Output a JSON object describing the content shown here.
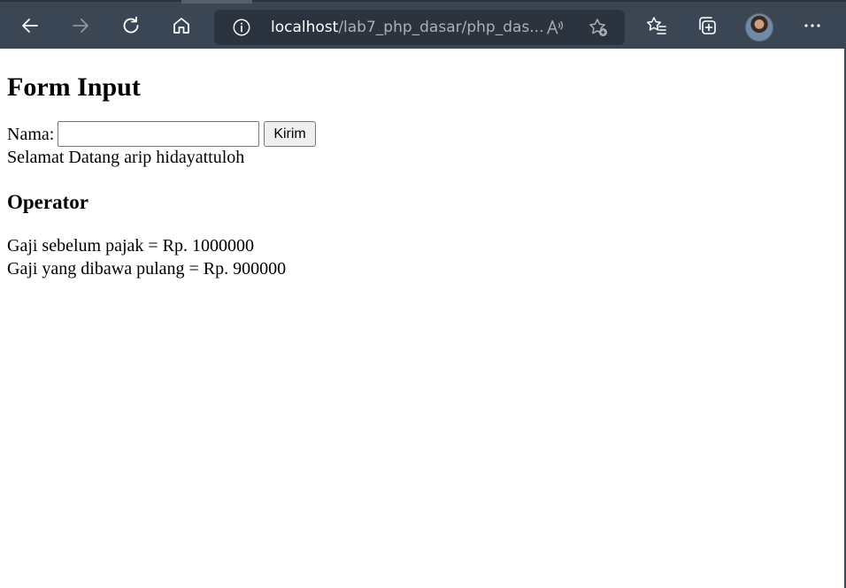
{
  "browser": {
    "url_host": "localhost",
    "url_path": "/lab7_php_dasar/php_das...",
    "icons": {
      "back": "arrow-left-icon",
      "forward": "arrow-right-icon",
      "refresh": "refresh-icon",
      "home": "home-icon",
      "site_info": "info-circle-icon",
      "read_aloud": "read-aloud-icon",
      "add_favorite": "star-add-icon",
      "favorites": "favorites-list-icon",
      "collections": "collections-icon",
      "profile": "avatar",
      "more": "more-dots-icon"
    },
    "colors": {
      "toolbar_bg": "#3b4654",
      "address_bg": "#2b333e",
      "icon_color": "#ffffff",
      "icon_disabled": "#8d96a1"
    }
  },
  "page": {
    "title": "Form Input",
    "form": {
      "name_label": "Nama:",
      "name_value": "",
      "submit_label": "Kirim"
    },
    "greeting": "Selamat Datang arip hidayattuloh",
    "section_heading": "Operator",
    "salary_before_tax": "Gaji sebelum pajak = Rp. 1000000",
    "salary_take_home": "Gaji yang dibawa pulang = Rp. 900000"
  }
}
